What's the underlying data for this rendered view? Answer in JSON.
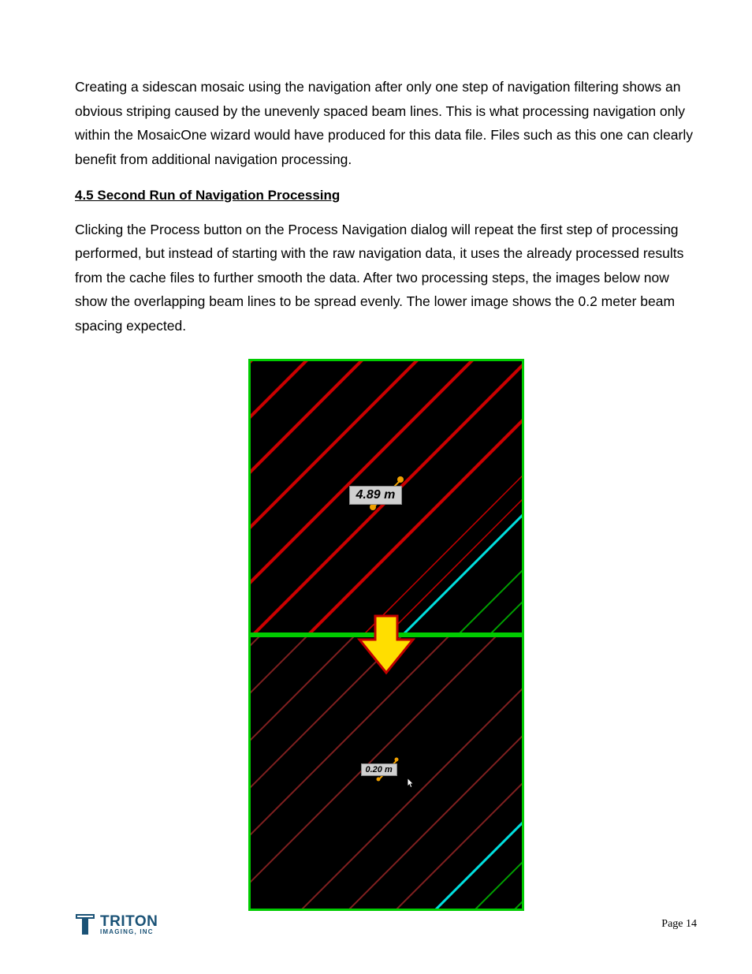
{
  "paragraph1": "Creating a sidescan mosaic using the navigation after only one step of navigation filtering shows an obvious striping caused by the unevenly spaced beam lines.  This is what processing navigation only within the MosaicOne wizard would have produced for this data file.  Files such as this one can clearly benefit from additional navigation processing.",
  "subheading": "4.5 Second Run of Navigation Processing",
  "paragraph2": "Clicking the Process button on the Process Navigation dialog will repeat the first step of processing performed, but instead of starting with the raw navigation data, it uses the already processed results from the cache files to further smooth the data.  After two processing steps, the images below now show the overlapping beam lines to be spread evenly.  The lower image shows the 0.2 meter beam spacing expected.",
  "figures": {
    "top": {
      "measurement": "4.89 m"
    },
    "bottom": {
      "measurement": "0.20 m"
    }
  },
  "footer": {
    "brand_name": "TRITON",
    "brand_sub": "IMAGING, INC",
    "page_label": "Page 14"
  },
  "colors": {
    "figure_border": "#00cc00",
    "arrow_fill": "#ffde00",
    "arrow_stroke": "#c00000",
    "brand": "#1a5276"
  }
}
